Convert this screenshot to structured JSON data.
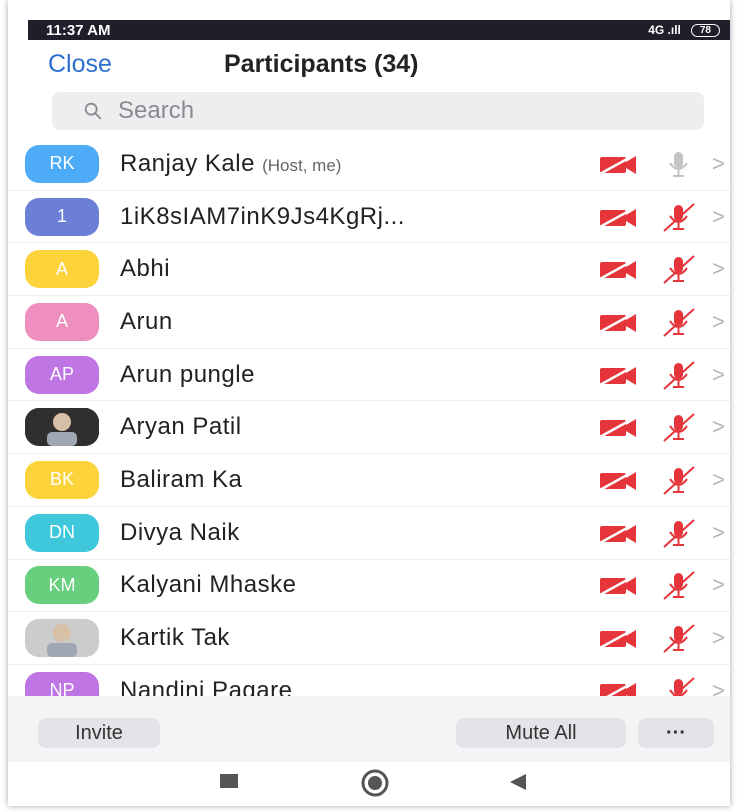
{
  "status": {
    "time": "11:37 AM",
    "signal": "4G .ıll",
    "battery": "78"
  },
  "header": {
    "close_label": "Close",
    "title": "Participants (34)"
  },
  "search": {
    "placeholder": "Search"
  },
  "participants": [
    {
      "initials": "RK",
      "name": "Ranjay Kale",
      "role": "(Host, me)",
      "color": "#4dabf7",
      "video": "off",
      "mic": "on"
    },
    {
      "initials": "1",
      "name": "1iK8sIAM7inK9Js4KgRj...",
      "role": "",
      "color": "#6b7fd7",
      "video": "off",
      "mic": "muted"
    },
    {
      "initials": "A",
      "name": "Abhi",
      "role": "",
      "color": "#fcd33a",
      "video": "off",
      "mic": "muted"
    },
    {
      "initials": "A",
      "name": "Arun",
      "role": "",
      "color": "#ef8fbf",
      "video": "off",
      "mic": "muted"
    },
    {
      "initials": "AP",
      "name": "Arun pungle",
      "role": "",
      "color": "#bf75e3",
      "video": "off",
      "mic": "muted"
    },
    {
      "initials": "",
      "name": "Aryan Patil",
      "role": "",
      "color": "#2f2f2f",
      "video": "off",
      "mic": "muted",
      "photo": true
    },
    {
      "initials": "BK",
      "name": "Baliram Ka",
      "role": "",
      "color": "#fcd33a",
      "video": "off",
      "mic": "muted"
    },
    {
      "initials": "DN",
      "name": "Divya Naik",
      "role": "",
      "color": "#3fc7db",
      "video": "off",
      "mic": "muted"
    },
    {
      "initials": "KM",
      "name": "Kalyani Mhaske",
      "role": "",
      "color": "#67cf7e",
      "video": "off",
      "mic": "muted"
    },
    {
      "initials": "",
      "name": "Kartik Tak",
      "role": "",
      "color": "#cccccc",
      "video": "off",
      "mic": "muted",
      "photo": true
    },
    {
      "initials": "NP",
      "name": "Nandini Pagare",
      "role": "",
      "color": "#bf75e3",
      "video": "off",
      "mic": "muted"
    }
  ],
  "footer": {
    "invite_label": "Invite",
    "mute_all_label": "Mute All",
    "more_label": "···"
  },
  "colors": {
    "accent": "#2d6fcf",
    "muted_red": "#e5343a"
  }
}
